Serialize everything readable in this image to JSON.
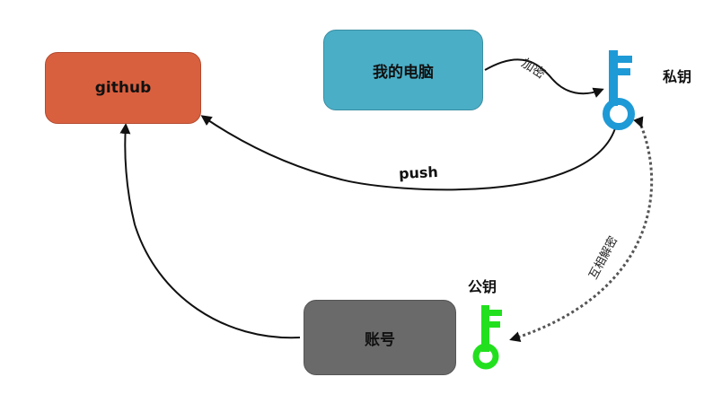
{
  "nodes": {
    "github": "github",
    "computer": "我的电脑",
    "account": "账号"
  },
  "keys": {
    "private_label": "私钥",
    "public_label": "公钥",
    "private_color": "#1e9ad6",
    "public_color": "#22e01e"
  },
  "edges": {
    "encrypt": "加密",
    "push": "push",
    "mutual": "互相解密"
  },
  "colors": {
    "github": "#d9603f",
    "computer": "#4aaec6",
    "account": "#6a6a6a"
  }
}
